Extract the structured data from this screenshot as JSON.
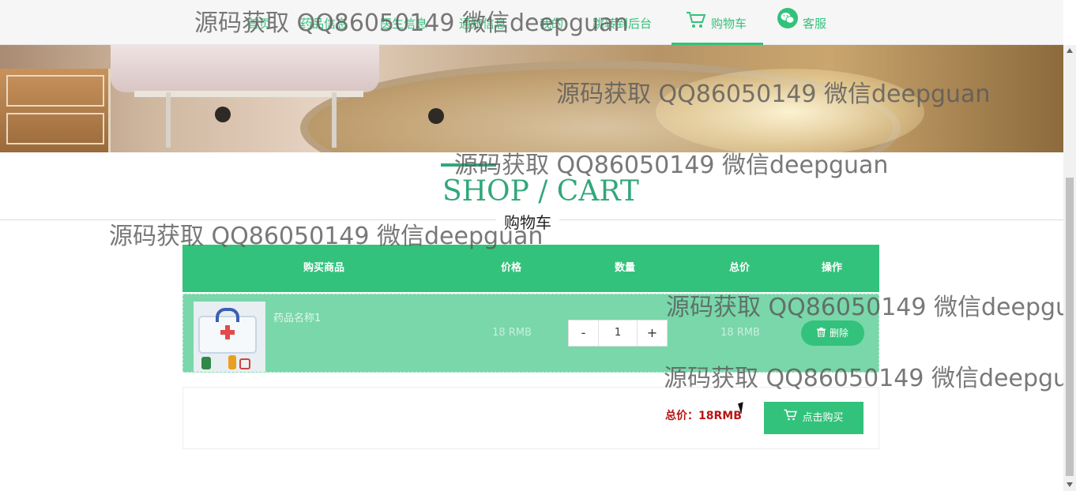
{
  "nav": {
    "items": [
      {
        "label": "首页"
      },
      {
        "label": "药品信息"
      },
      {
        "label": "医生信息"
      },
      {
        "label": "通知信息"
      },
      {
        "label": "我的"
      },
      {
        "label": "跳转到后台"
      },
      {
        "label": "购物车",
        "icon": "cart-icon",
        "active": true
      },
      {
        "label": "客服",
        "icon": "wechat-icon"
      }
    ]
  },
  "section": {
    "title_en": "SHOP / CART",
    "title_cn": "购物车"
  },
  "cart": {
    "columns": [
      "购买商品",
      "价格",
      "数量",
      "总价",
      "操作"
    ],
    "rows": [
      {
        "name": "药品名称1",
        "price": "18 RMB",
        "quantity": "1",
        "total": "18 RMB",
        "decrement": "-",
        "increment": "+",
        "delete_label": "删除"
      }
    ],
    "summary_label": "总价：18RMB",
    "buy_label": "点击购买"
  },
  "watermark": {
    "text": "源码获取 QQ86050149 微信deepguan"
  },
  "colors": {
    "accent": "#33c27b",
    "title": "#33a77a",
    "total_red": "#b81414"
  }
}
